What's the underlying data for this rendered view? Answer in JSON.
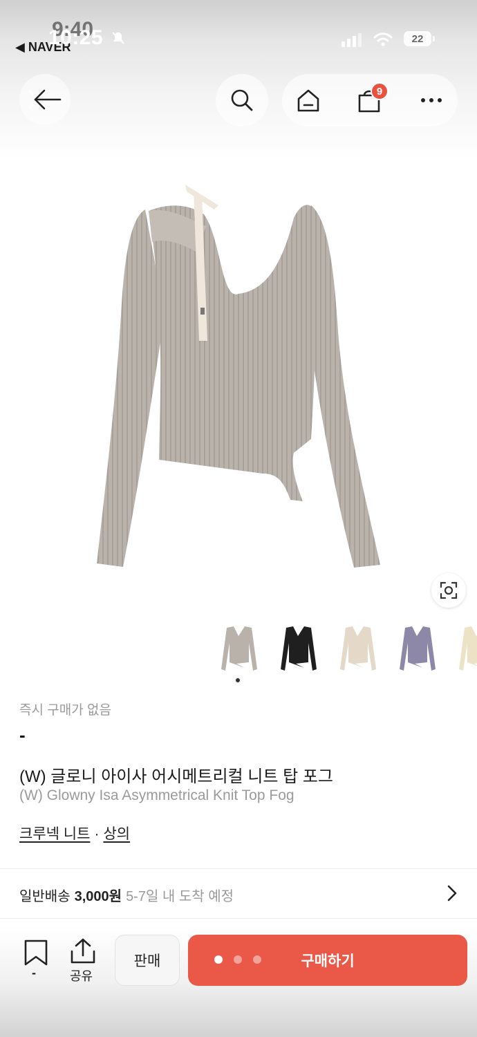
{
  "status_bar": {
    "time": "10:25",
    "time_behind": "9:40",
    "back_app": "◀ NAVER",
    "battery": "22"
  },
  "top_nav": {
    "cart_count": "9",
    "icons": [
      "close-icon",
      "back-arrow-icon",
      "search-icon",
      "home-icon",
      "shopping-bag-icon",
      "more-icon"
    ]
  },
  "product": {
    "image_alt": "grey ribbed asymmetrical knit top",
    "color_options": [
      "grey",
      "black",
      "cream",
      "lavender",
      "beige"
    ],
    "colors": {
      "grey": "#b8b2ab",
      "black": "#1f1f1f",
      "cream": "#e4d9c8",
      "lavender": "#8d88a8",
      "beige": "#ece2c6"
    },
    "no_instant_purchase": "즉시 구매가 없음",
    "price": "-",
    "name_ko": "(W) 글로니 아이사 어시메트리컬 니트 탑 포그",
    "name_en": "(W) Glowny Isa Asymmetrical Knit Top Fog",
    "category_1": "크루넥 니트",
    "category_sep": "·",
    "category_2": "상의"
  },
  "shipping": {
    "label": "일반배송",
    "price": "3,000원",
    "eta": "5-7일 내 도착 예정"
  },
  "bottom_bar": {
    "bookmark_count": "-",
    "share_label": "공유",
    "sell_label": "판매",
    "buy_label": "구매하기",
    "accent_color": "#ea5947"
  }
}
